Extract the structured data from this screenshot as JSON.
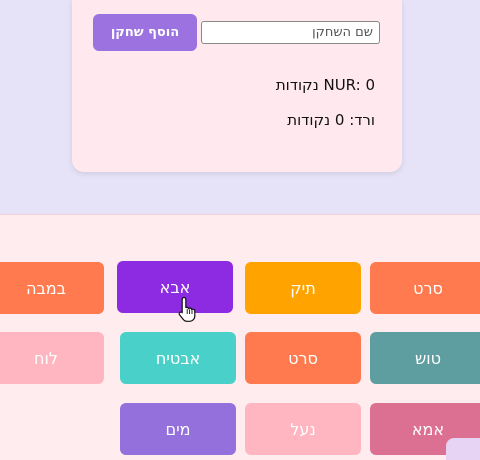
{
  "player_form": {
    "name_placeholder": "שם השחקן",
    "add_button_label": "הוסף שחקן"
  },
  "scores": [
    "NUR: 0 נקודות",
    "ורד: 0 נקודות"
  ],
  "words": [
    {
      "label": "במבה",
      "color": "#ff7b4f"
    },
    {
      "label": "אבא",
      "color": "#8c2be2"
    },
    {
      "label": "תיק",
      "color": "#ffa300"
    },
    {
      "label": "סרט",
      "color": "#ff7b4f"
    },
    {
      "label": "לוח",
      "color": "#ffb6c1"
    },
    {
      "label": "אבטיח",
      "color": "#49d1c9"
    },
    {
      "label": "סרט",
      "color": "#ff7b4f"
    },
    {
      "label": "טוש",
      "color": "#5f9ea0"
    },
    {
      "label": "מים",
      "color": "#9370db"
    },
    {
      "label": "נעל",
      "color": "#ffb6c1"
    },
    {
      "label": "אמא",
      "color": "#db7093"
    }
  ]
}
